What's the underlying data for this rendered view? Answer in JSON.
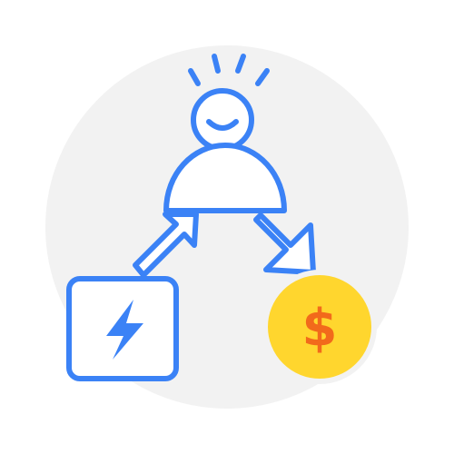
{
  "illustration": {
    "colors": {
      "background_circle": "#F2F2F2",
      "line": "#3B82F6",
      "card_fill": "#FFFFFF",
      "coin_fill": "#FFD62E",
      "coin_symbol": "#F26A1B"
    },
    "icons": {
      "person": "person-icon",
      "left_arrow": "arrow-up-right-icon",
      "right_arrow": "arrow-down-right-icon",
      "energy_card": "lightning-bolt-icon",
      "coin": "dollar-coin-icon"
    },
    "coin": {
      "symbol": "$"
    }
  }
}
